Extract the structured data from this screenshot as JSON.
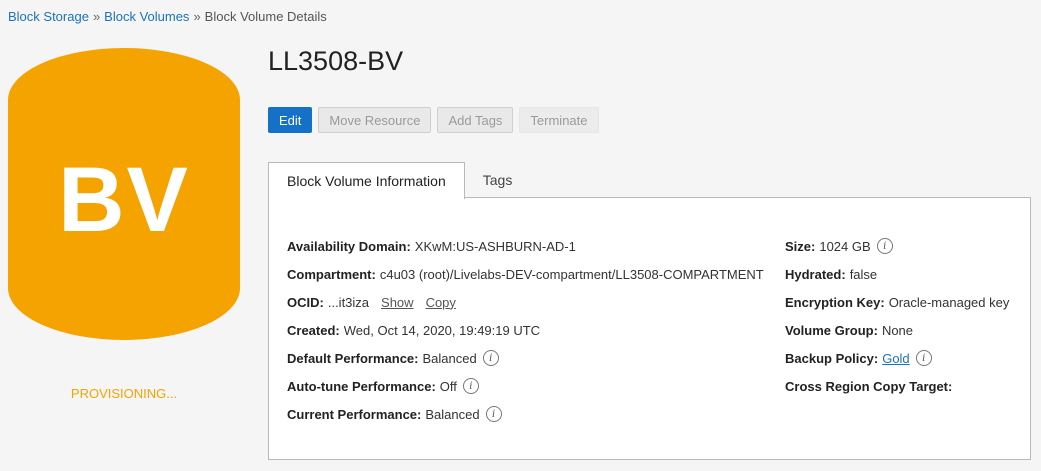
{
  "breadcrumb": {
    "items": [
      {
        "label": "Block Storage"
      },
      {
        "label": "Block Volumes"
      }
    ],
    "separator": "»",
    "current": "Block Volume Details"
  },
  "resource": {
    "icon_text": "BV",
    "icon_color": "#f5a300",
    "status": "PROVISIONING...",
    "title": "LL3508-BV"
  },
  "actions": {
    "edit": "Edit",
    "move": "Move Resource",
    "tags": "Add Tags",
    "terminate": "Terminate"
  },
  "tabs": [
    {
      "label": "Block Volume Information",
      "active": true
    },
    {
      "label": "Tags",
      "active": false
    }
  ],
  "info": {
    "availability_domain": {
      "label": "Availability Domain:",
      "value": "XKwM:US-ASHBURN-AD-1"
    },
    "compartment": {
      "label": "Compartment:",
      "value": "c4u03 (root)/Livelabs-DEV-compartment/LL3508-COMPARTMENT"
    },
    "ocid": {
      "label": "OCID:",
      "value": "...it3iza",
      "show": "Show",
      "copy": "Copy"
    },
    "created": {
      "label": "Created:",
      "value": "Wed, Oct 14, 2020, 19:49:19 UTC"
    },
    "default_performance": {
      "label": "Default Performance:",
      "value": "Balanced"
    },
    "autotune_performance": {
      "label": "Auto-tune Performance:",
      "value": "Off"
    },
    "current_performance": {
      "label": "Current Performance:",
      "value": "Balanced"
    },
    "size": {
      "label": "Size:",
      "value": "1024 GB"
    },
    "hydrated": {
      "label": "Hydrated:",
      "value": "false"
    },
    "encryption_key": {
      "label": "Encryption Key:",
      "value": "Oracle-managed key"
    },
    "volume_group": {
      "label": "Volume Group:",
      "value": "None"
    },
    "backup_policy": {
      "label": "Backup Policy:",
      "value": "Gold"
    },
    "cross_region": {
      "label": "Cross Region Copy Target:",
      "value": ""
    }
  },
  "info_icon_glyph": "i"
}
